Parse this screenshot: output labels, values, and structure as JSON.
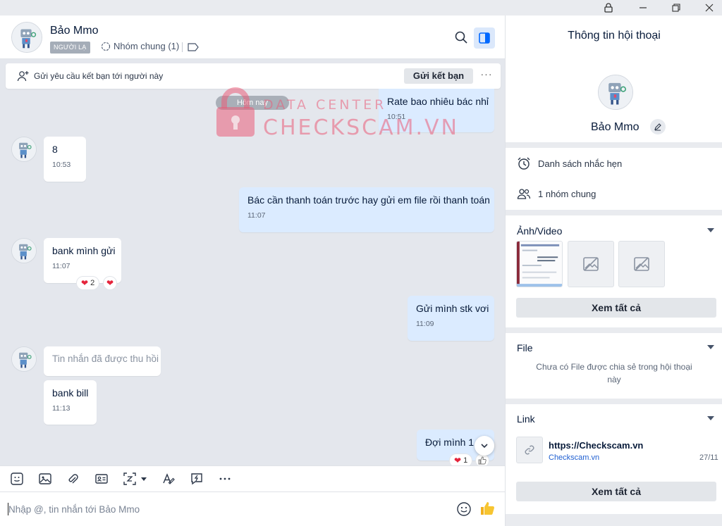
{
  "chat": {
    "contact_name": "Bảo Mmo",
    "stranger_tag": "NGƯỜI LẠ",
    "common_group": "Nhóm chung (1)",
    "friend_request_text": "Gửi yêu cầu kết bạn tới người này",
    "friend_request_button": "Gửi kết bạn",
    "more_label": "···",
    "date_divider": "Hôm nay",
    "messages": [
      {
        "dir": "out",
        "text": "Rate bao nhiêu bác nhỉ",
        "time": "10:51"
      },
      {
        "dir": "in",
        "text": "8",
        "time": "10:53"
      },
      {
        "dir": "out",
        "text": "Bác cần thanh toán trước hay gửi em file rồi thanh toán",
        "time": "11:07"
      },
      {
        "dir": "in",
        "text": "bank mình gửi",
        "time": "11:07",
        "reaction_count": "2"
      },
      {
        "dir": "out",
        "text": "Gửi mình stk vơi",
        "time": "11:09"
      },
      {
        "dir": "in",
        "text": "Tin nhắn đã được thu hồi",
        "time": ""
      },
      {
        "dir": "in",
        "text": "bank bill",
        "time": "11:13"
      },
      {
        "dir": "out",
        "text": "Đợi mình 1 l",
        "time": "",
        "reaction_count": "1"
      }
    ],
    "composer_placeholder": "Nhập @, tin nhắn tới Bảo Mmo"
  },
  "watermark": {
    "line1": "DATA CENTER",
    "line2": "CHECKSCAM.VN"
  },
  "info": {
    "title": "Thông tin hội thoại",
    "name": "Bảo Mmo",
    "reminders": "Danh sách nhắc hẹn",
    "common_groups": "1 nhóm chung",
    "media_title": "Ảnh/Video",
    "see_all": "Xem tất cả",
    "file_title": "File",
    "file_empty": "Chưa có File được chia sẻ trong hội thoại này",
    "link_title": "Link",
    "link_url": "https://Checkscam.vn",
    "link_domain": "Checkscam.vn",
    "link_date": "27/11"
  },
  "colors": {
    "accent": "#0068ff",
    "outgoing_bubble": "#dbebff",
    "heart": "#e5243b"
  }
}
